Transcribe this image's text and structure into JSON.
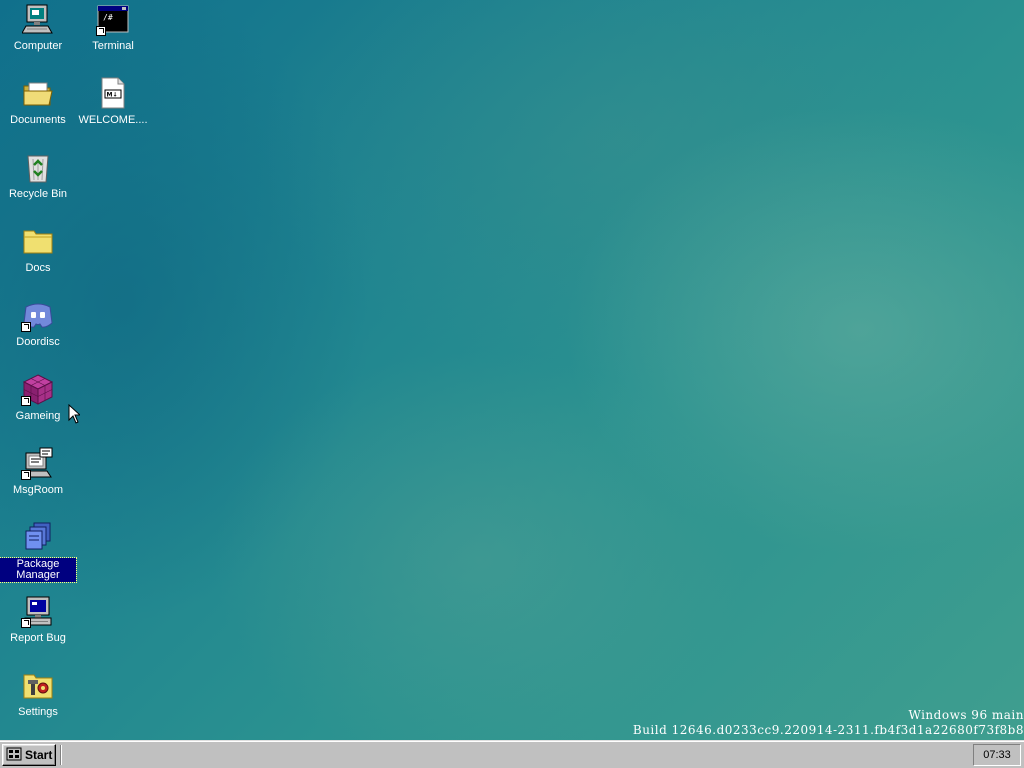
{
  "desktop": {
    "icons": [
      {
        "label": "Computer",
        "icon": "computer-icon"
      },
      {
        "label": "Terminal",
        "icon": "terminal-icon"
      },
      {
        "label": "Documents",
        "icon": "open-folder-icon"
      },
      {
        "label": "WELCOME....",
        "icon": "markdown-file-icon"
      },
      {
        "label": "Recycle Bin",
        "icon": "recycle-bin-icon"
      },
      {
        "label": "Docs",
        "icon": "folder-icon"
      },
      {
        "label": "Doordisc",
        "icon": "doordisc-icon"
      },
      {
        "label": "Gameing",
        "icon": "game-cube-icon"
      },
      {
        "label": "MsgRoom",
        "icon": "msgroom-icon"
      },
      {
        "label": "Package Manager",
        "icon": "package-icon",
        "selected": true
      },
      {
        "label": "Report Bug",
        "icon": "report-bug-icon"
      },
      {
        "label": "Settings",
        "icon": "settings-icon"
      }
    ],
    "watermark": {
      "line1": "Windows 96 main",
      "line2": "Build 12646.d0233cc9.220914-2311.fb4f3d1a22680f73f8b8"
    }
  },
  "taskbar": {
    "start_label": "Start",
    "clock": "07:33"
  },
  "colors": {
    "desktop_teal": "#1f8490",
    "taskbar_gray": "#c0c0c0",
    "selection_navy": "#000080"
  }
}
